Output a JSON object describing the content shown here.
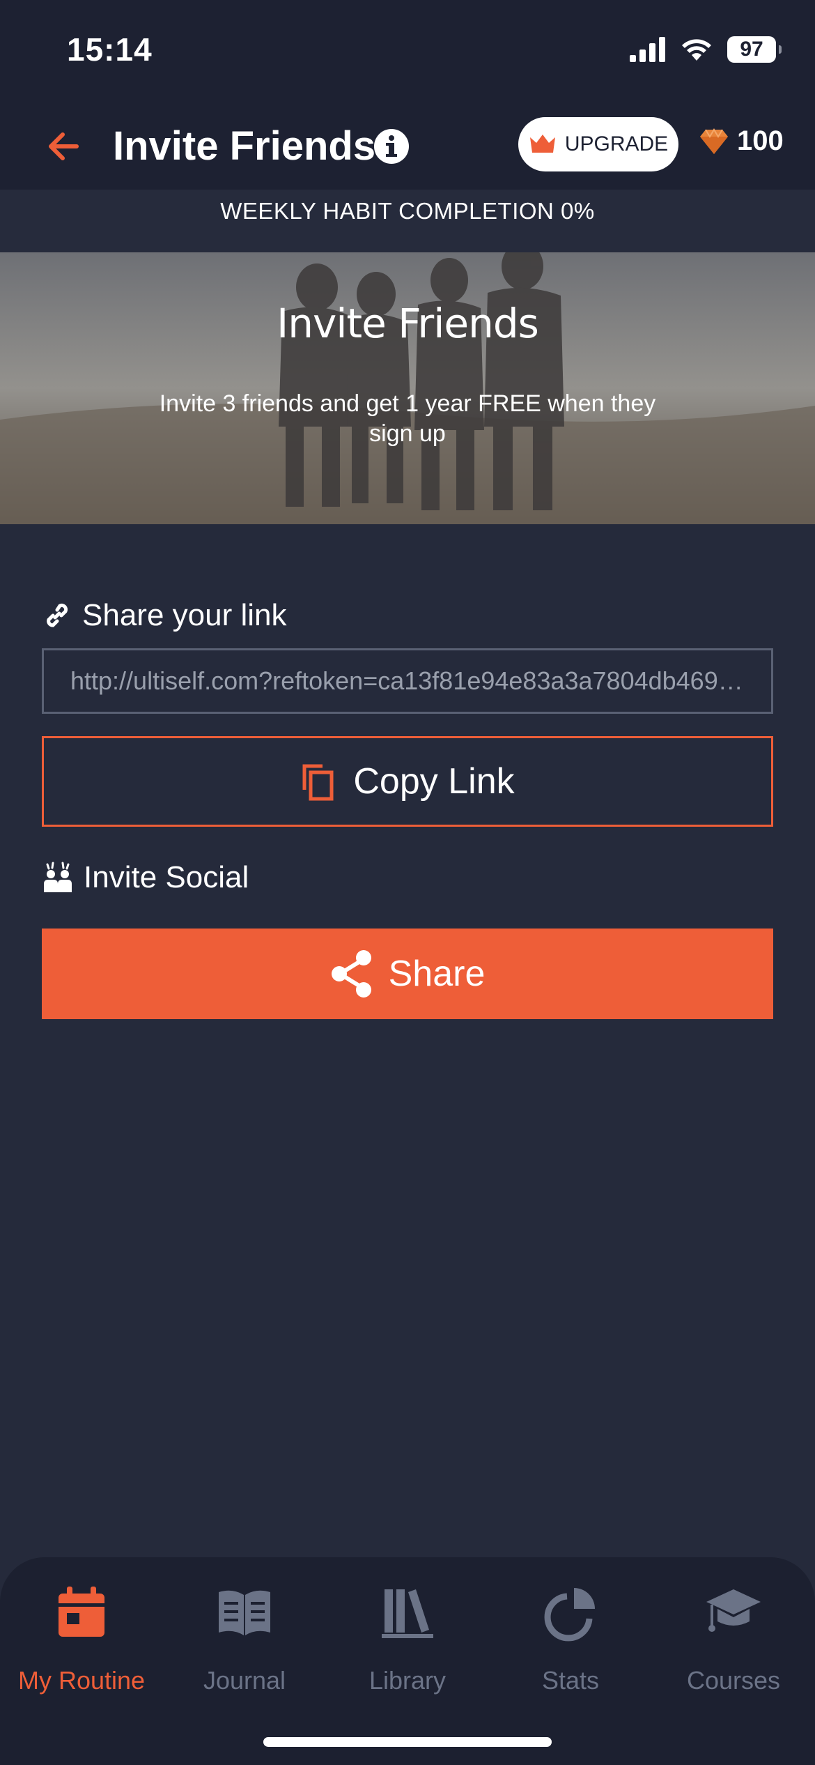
{
  "status_bar": {
    "time": "15:14",
    "battery": "97"
  },
  "header": {
    "title": "Invite Friends",
    "upgrade_label": "UPGRADE",
    "gems": "100"
  },
  "weekly_banner": "WEEKLY HABIT COMPLETION 0%",
  "hero": {
    "title": "Invite Friends",
    "subtitle": "Invite 3 friends and get 1 year FREE when they sign up"
  },
  "share_link": {
    "label": "Share your link",
    "url": "http://ultiself.com?reftoken=ca13f81e94e83a3a7804db4691..."
  },
  "copy_button": {
    "label": "Copy Link"
  },
  "invite_social": {
    "label": "Invite Social",
    "share_label": "Share"
  },
  "bottom_nav": {
    "items": [
      {
        "label": "My Routine",
        "icon": "calendar-icon",
        "active": true
      },
      {
        "label": "Journal",
        "icon": "book-icon",
        "active": false
      },
      {
        "label": "Library",
        "icon": "library-icon",
        "active": false
      },
      {
        "label": "Stats",
        "icon": "pie-chart-icon",
        "active": false
      },
      {
        "label": "Courses",
        "icon": "graduation-cap-icon",
        "active": false
      }
    ]
  },
  "colors": {
    "accent": "#ee5e38",
    "background": "#252a3b",
    "header": "#1d2132",
    "inactive": "#6b7387"
  }
}
